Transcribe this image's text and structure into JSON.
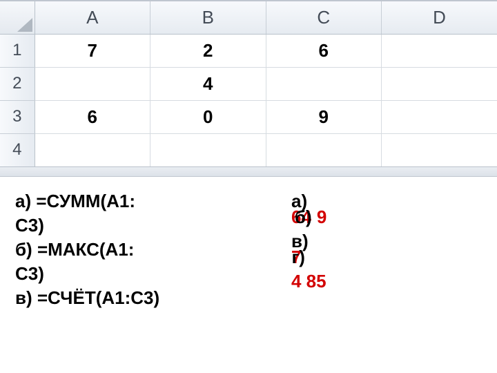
{
  "columns": {
    "A": "A",
    "B": "B",
    "C": "C",
    "D": "D"
  },
  "rows": {
    "r1": "1",
    "r2": "2",
    "r3": "3",
    "r4": "4"
  },
  "cells": {
    "A1": "7",
    "B1": "2",
    "C1": "6",
    "D1": "",
    "A2": "",
    "B2": "4",
    "C2": "",
    "D2": "",
    "A3": "6",
    "B3": "0",
    "C3": "9",
    "D3": "",
    "A4": "",
    "B4": "",
    "C4": "",
    "D4": ""
  },
  "questions": {
    "a1": "а)  =СУММ(А1:",
    "a2": "С3)",
    "b1": "б)  =МАКС(А1:",
    "b2": "С3)",
    "c1_partial": "в)  =СЧЁТ(А1:С3)"
  },
  "answers": {
    "a_label": "а)",
    "a_red": "64",
    "b_label": "б)",
    "b_red": "  9",
    "v_label": "в)",
    "v_red": "7",
    "g_label": "г)",
    "g_red": "4 85"
  }
}
